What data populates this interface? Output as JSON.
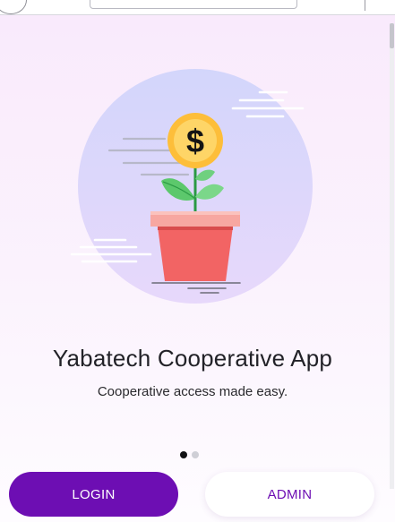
{
  "app": {
    "title": "Yabatech Cooperative App",
    "tagline": "Cooperative access made easy."
  },
  "illustration": {
    "coin_symbol": "$",
    "description_icon": "money-plant-icon"
  },
  "carousel": {
    "total_slides": 2,
    "active_slide": 1
  },
  "actions": {
    "login_label": "LOGIN",
    "admin_label": "ADMIN"
  },
  "colors": {
    "primary": "#6d0eb3",
    "background": "#f9eafc",
    "circle": "#d6d9fb",
    "coin": "#fdc84a",
    "pot": "#f26464",
    "leaf": "#3dbb5a"
  }
}
